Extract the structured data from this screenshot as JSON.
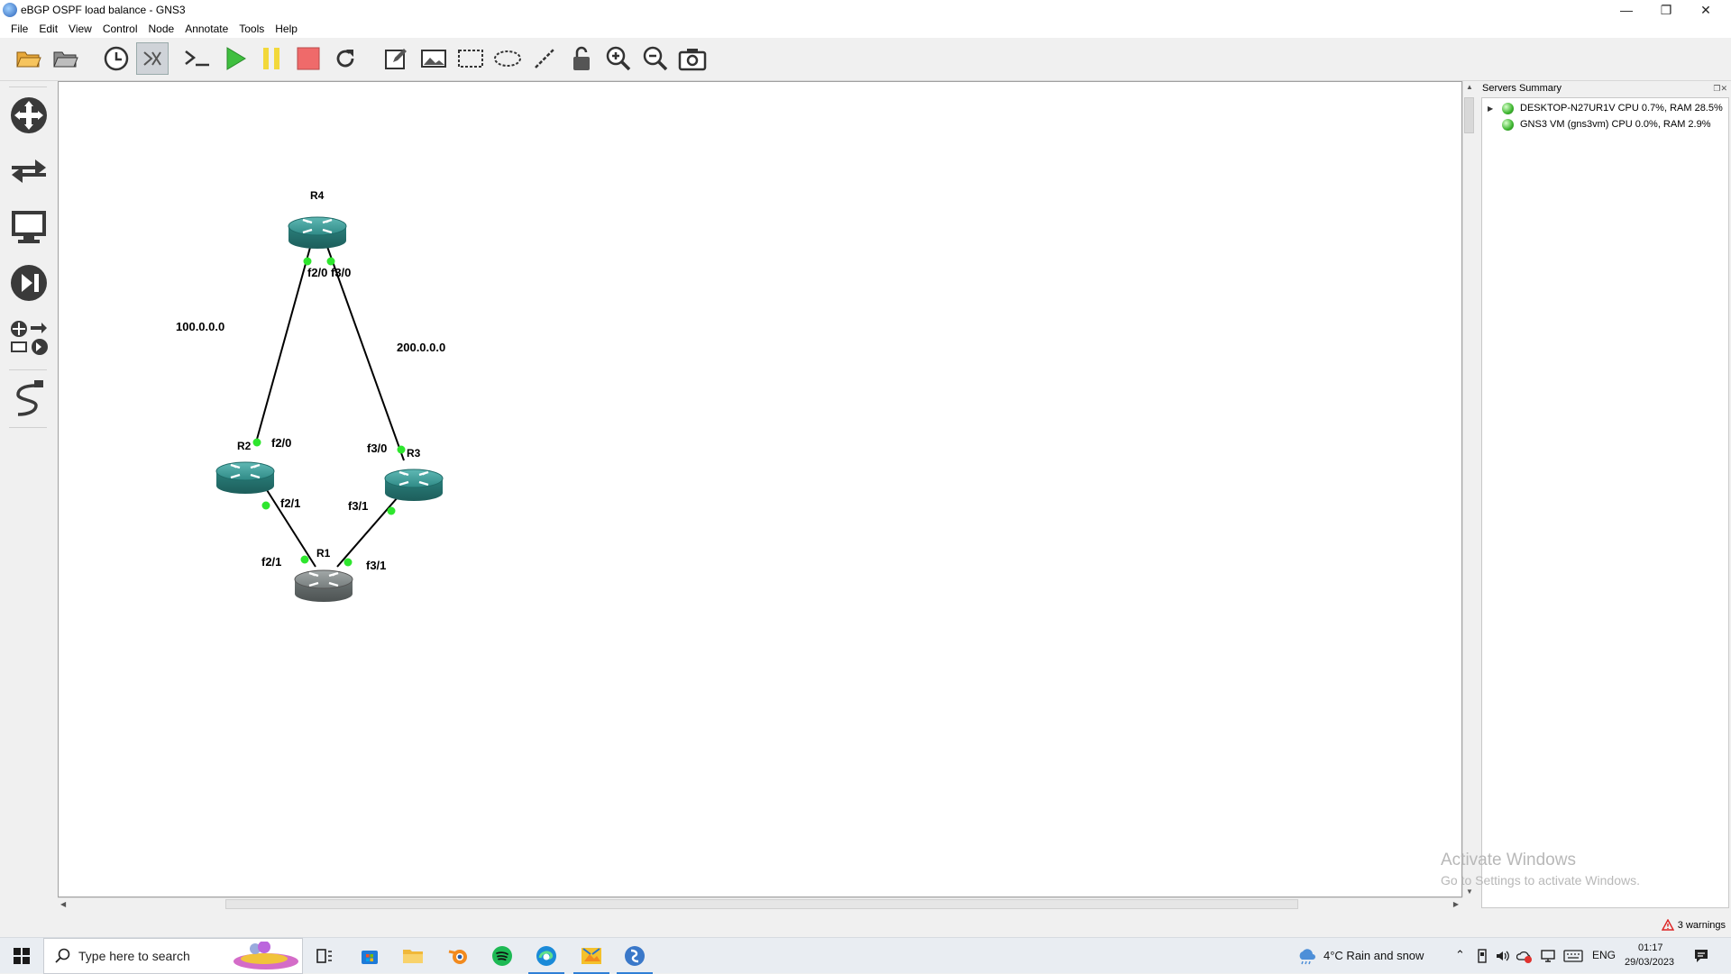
{
  "window": {
    "title": "eBGP OSPF load balance - GNS3"
  },
  "menubar": {
    "items": [
      "File",
      "Edit",
      "View",
      "Control",
      "Node",
      "Annotate",
      "Tools",
      "Help"
    ]
  },
  "toolbar": {
    "buttons": [
      "open-project-icon",
      "open-folder-icon",
      "snapshot-clock-icon",
      "show-interface-labels-icon",
      "console-icon",
      "start-icon",
      "suspend-icon",
      "stop-icon",
      "reload-icon",
      "add-note-icon",
      "insert-image-icon",
      "draw-rectangle-icon",
      "draw-ellipse-icon",
      "draw-line-icon",
      "lock-icon",
      "zoom-in-icon",
      "zoom-out-icon",
      "screenshot-icon"
    ]
  },
  "topology": {
    "nodes": [
      {
        "id": "R4",
        "label": "R4",
        "status": "started"
      },
      {
        "id": "R2",
        "label": "R2",
        "status": "started"
      },
      {
        "id": "R3",
        "label": "R3",
        "status": "started"
      },
      {
        "id": "R1",
        "label": "R1",
        "status": "stopped"
      }
    ],
    "links": [
      {
        "a": "R4",
        "a_port": "f2/0",
        "b": "R2",
        "b_port": "f2/0"
      },
      {
        "a": "R4",
        "a_port": "f3/0",
        "b": "R3",
        "b_port": "f3/0"
      },
      {
        "a": "R2",
        "a_port": "f2/1",
        "b": "R1",
        "b_port": "f2/1"
      },
      {
        "a": "R3",
        "a_port": "f3/1",
        "b": "R1",
        "b_port": "f3/1"
      }
    ],
    "notes": [
      "100.0.0.0",
      "200.0.0.0"
    ],
    "port_labels": {
      "r4_f20": "f2/0",
      "r4_f30": "f3/0",
      "r2_f20": "f2/0",
      "r2_f21": "f2/1",
      "r3_f30": "f3/0",
      "r3_f31": "f3/1",
      "r1_f21": "f2/1",
      "r1_f31": "f3/1"
    }
  },
  "servers": {
    "title": "Servers Summary",
    "items": [
      {
        "label": "DESKTOP-N27UR1V CPU 0.7%, RAM 28.5%",
        "status_color": "#3cb52e"
      },
      {
        "label": "GNS3 VM (gns3vm) CPU 0.0%, RAM 2.9%",
        "status_color": "#3cb52e"
      }
    ]
  },
  "watermark": {
    "line1": "Activate Windows",
    "line2": "Go to Settings to activate Windows."
  },
  "statusbar": {
    "warnings": "3 warnings"
  },
  "taskbar": {
    "search_placeholder": "Type here to search",
    "weather": "4°C  Rain and snow",
    "language": "ENG",
    "time": "01:17",
    "date": "29/03/2023"
  }
}
